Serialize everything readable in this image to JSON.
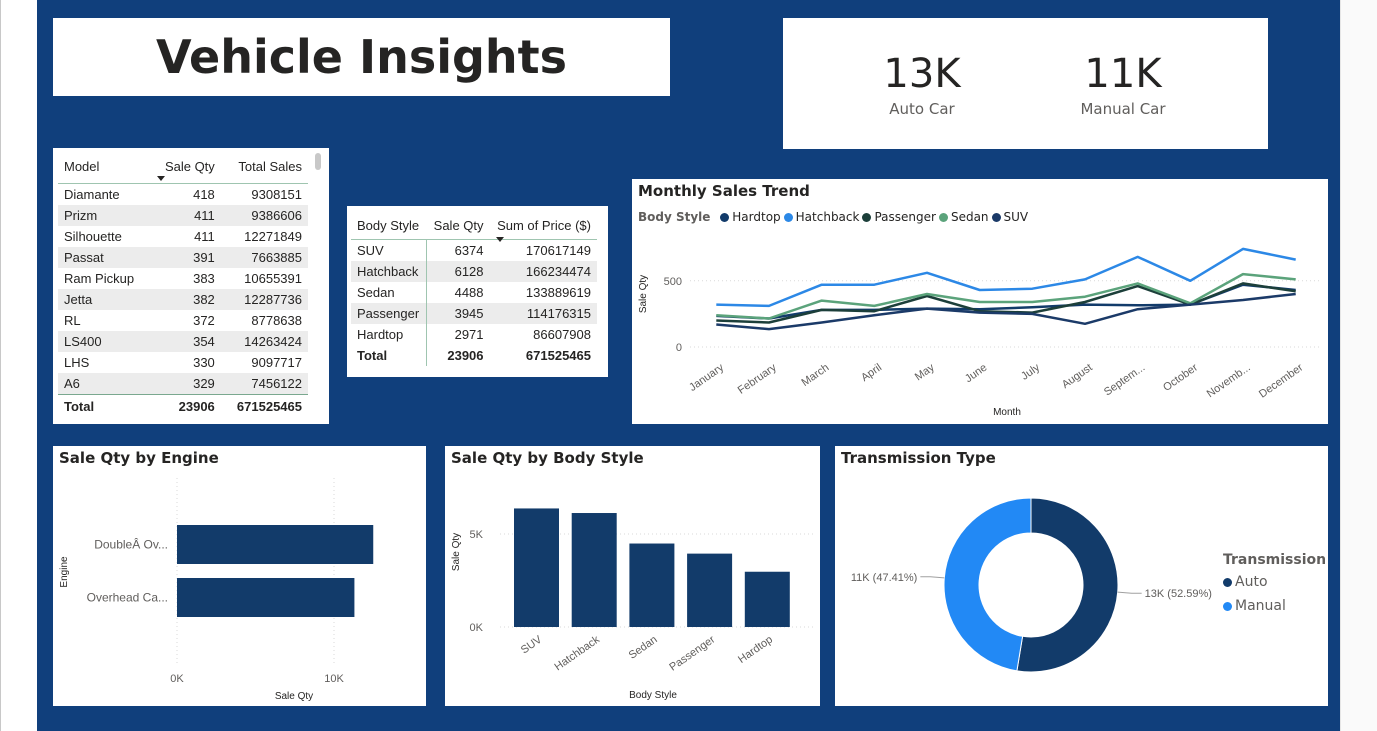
{
  "title": "Vehicle Insights",
  "kpis": [
    {
      "value": "13K",
      "label": "Auto Car"
    },
    {
      "value": "11K",
      "label": "Manual Car"
    }
  ],
  "colors": {
    "canvas": "#103f7c",
    "navy": "#123b6a",
    "blue": "#2c88e6",
    "dark_green": "#1c3f3a",
    "green": "#5ba37b",
    "suv": "#1b3a68",
    "auto": "#123b6a",
    "manual": "#2289f5"
  },
  "model_table": {
    "headers": [
      "Model",
      "Sale Qty",
      "Total Sales"
    ],
    "rows": [
      [
        "Diamante",
        "418",
        "9308151"
      ],
      [
        "Prizm",
        "411",
        "9386606"
      ],
      [
        "Silhouette",
        "411",
        "12271849"
      ],
      [
        "Passat",
        "391",
        "7663885"
      ],
      [
        "Ram Pickup",
        "383",
        "10655391"
      ],
      [
        "Jetta",
        "382",
        "12287736"
      ],
      [
        "RL",
        "372",
        "8778638"
      ],
      [
        "LS400",
        "354",
        "14263424"
      ],
      [
        "LHS",
        "330",
        "9097717"
      ],
      [
        "A6",
        "329",
        "7456122"
      ]
    ],
    "total": [
      "Total",
      "23906",
      "671525465"
    ]
  },
  "body_table": {
    "headers": [
      "Body Style",
      "Sale Qty",
      "Sum of Price ($)"
    ],
    "rows": [
      [
        "SUV",
        "6374",
        "170617149"
      ],
      [
        "Hatchback",
        "6128",
        "166234474"
      ],
      [
        "Sedan",
        "4488",
        "133889619"
      ],
      [
        "Passenger",
        "3945",
        "114176315"
      ],
      [
        "Hardtop",
        "2971",
        "86607908"
      ]
    ],
    "total": [
      "Total",
      "23906",
      "671525465"
    ]
  },
  "chart_data": [
    {
      "type": "line",
      "title": "Monthly Sales Trend",
      "legend_title": "Body Style",
      "legend_position": "top-left",
      "xlabel": "Month",
      "ylabel": "Sale Qty",
      "categories": [
        "January",
        "February",
        "March",
        "April",
        "May",
        "June",
        "July",
        "August",
        "Septem...",
        "October",
        "Novemb...",
        "December"
      ],
      "y_ticks": [
        "0",
        "500"
      ],
      "ylim": [
        0,
        800
      ],
      "grid": true,
      "series": [
        {
          "name": "Hardtop",
          "color": "#123b6a",
          "values": [
            235,
            215,
            280,
            280,
            290,
            285,
            300,
            320,
            315,
            320,
            470,
            430
          ]
        },
        {
          "name": "Hatchback",
          "color": "#2c88e6",
          "values": [
            320,
            310,
            470,
            470,
            560,
            430,
            440,
            510,
            680,
            500,
            740,
            660
          ]
        },
        {
          "name": "Passenger",
          "color": "#1c3f3a",
          "values": [
            200,
            185,
            280,
            270,
            385,
            270,
            260,
            340,
            460,
            320,
            480,
            420
          ]
        },
        {
          "name": "Sedan",
          "color": "#5ba37b",
          "values": [
            240,
            215,
            350,
            310,
            400,
            340,
            340,
            380,
            480,
            330,
            550,
            510
          ]
        },
        {
          "name": "SUV",
          "color": "#1b3a68",
          "values": [
            170,
            135,
            185,
            240,
            290,
            260,
            250,
            175,
            285,
            320,
            355,
            400
          ]
        }
      ]
    },
    {
      "type": "bar",
      "title": "Sale Qty by Engine",
      "orientation": "horizontal",
      "categories": [
        "DoubleÂ Ov...",
        "Overhead Ca..."
      ],
      "values": [
        12500,
        11300
      ],
      "xlabel": "Sale Qty",
      "ylabel": "Engine",
      "x_ticks": [
        "0K",
        "10K"
      ],
      "xlim": [
        0,
        13000
      ],
      "grid": true
    },
    {
      "type": "bar",
      "title": "Sale Qty by Body Style",
      "categories": [
        "SUV",
        "Hatchback",
        "Sedan",
        "Passenger",
        "Hardtop"
      ],
      "values": [
        6374,
        6128,
        4488,
        3945,
        2971
      ],
      "xlabel": "Body Style",
      "ylabel": "Sale Qty",
      "y_ticks": [
        "0K",
        "5K"
      ],
      "ylim": [
        0,
        7000
      ],
      "grid": true
    },
    {
      "type": "pie",
      "title": "Transmission Type",
      "donut": true,
      "legend_title": "Transmission",
      "legend_position": "right",
      "labels": [
        "Auto",
        "Manual"
      ],
      "values": [
        52.59,
        47.41
      ],
      "data_labels": [
        "13K (52.59%)",
        "11K (47.41%)"
      ]
    }
  ]
}
